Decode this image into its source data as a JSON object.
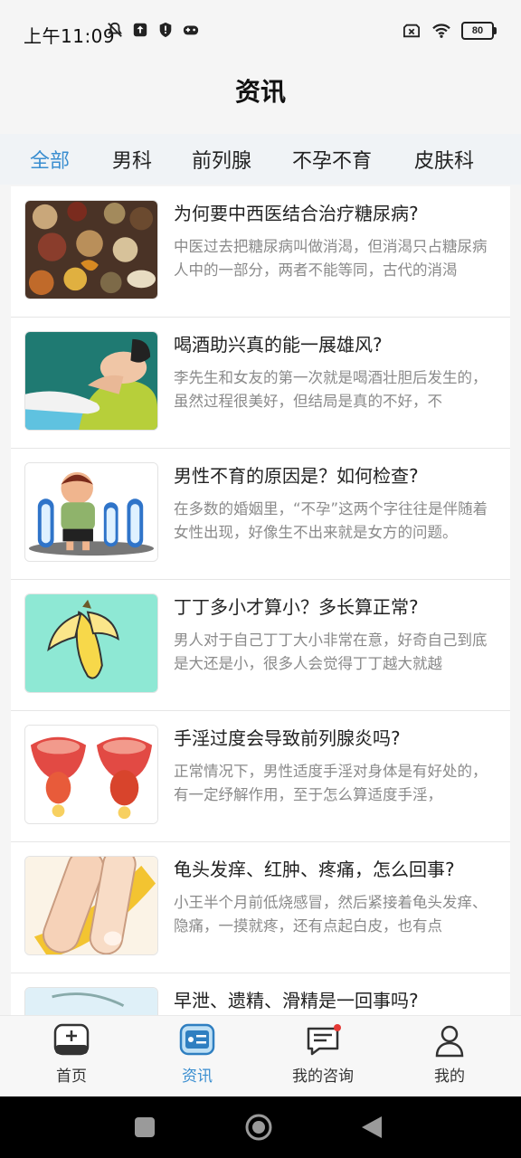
{
  "status_bar": {
    "time": "上午11:09",
    "icons": [
      "mute-bell-icon",
      "upload-icon",
      "shield-alert-icon",
      "gamepad-icon"
    ],
    "right_icons": [
      "sim-off-icon",
      "wifi-icon",
      "battery-icon"
    ],
    "battery_level": "80"
  },
  "header": {
    "title": "资讯"
  },
  "tabs": [
    {
      "label": "全部",
      "active": true
    },
    {
      "label": "男科"
    },
    {
      "label": "前列腺"
    },
    {
      "label": "不孕不育"
    },
    {
      "label": "皮肤科"
    }
  ],
  "articles": [
    {
      "title": "为何要中西医结合治疗糖尿病?",
      "summary": "中医过去把糖尿病叫做消渴，但消渴只占糖尿病人中的一部分，两者不能等同，古代的消渴"
    },
    {
      "title": "喝酒助兴真的能一展雄风?",
      "summary": "李先生和女友的第一次就是喝酒壮胆后发生的，虽然过程很美好，但结局是真的不好，不"
    },
    {
      "title": "男性不育的原因是？如何检查?",
      "summary": "在多数的婚姻里，“不孕”这两个字往往是伴随着女性出现，好像生不出来就是女方的问题。"
    },
    {
      "title": "丁丁多小才算小？多长算正常?",
      "summary": "男人对于自己丁丁大小非常在意，好奇自己到底是大还是小，很多人会觉得丁丁越大就越"
    },
    {
      "title": "手淫过度会导致前列腺炎吗?",
      "summary": "正常情况下，男性适度手淫对身体是有好处的，有一定纾解作用，至于怎么算适度手淫，"
    },
    {
      "title": "龟头发痒、红肿、疼痛，怎么回事?",
      "summary": "小王半个月前低烧感冒，然后紧接着龟头发痒、隐痛，一摸就疼，还有点起白皮，也有点"
    },
    {
      "title": "早泄、遗精、滑精是一回事吗?",
      "summary": ""
    }
  ],
  "bottom_nav": [
    {
      "label": "首页",
      "icon": "home-plus-icon"
    },
    {
      "label": "资讯",
      "icon": "news-icon",
      "active": true
    },
    {
      "label": "我的咨询",
      "icon": "consult-chat-icon",
      "badge": true
    },
    {
      "label": "我的",
      "icon": "user-icon"
    }
  ],
  "colors": {
    "accent": "#3a8ed0",
    "badge": "#e53935"
  }
}
